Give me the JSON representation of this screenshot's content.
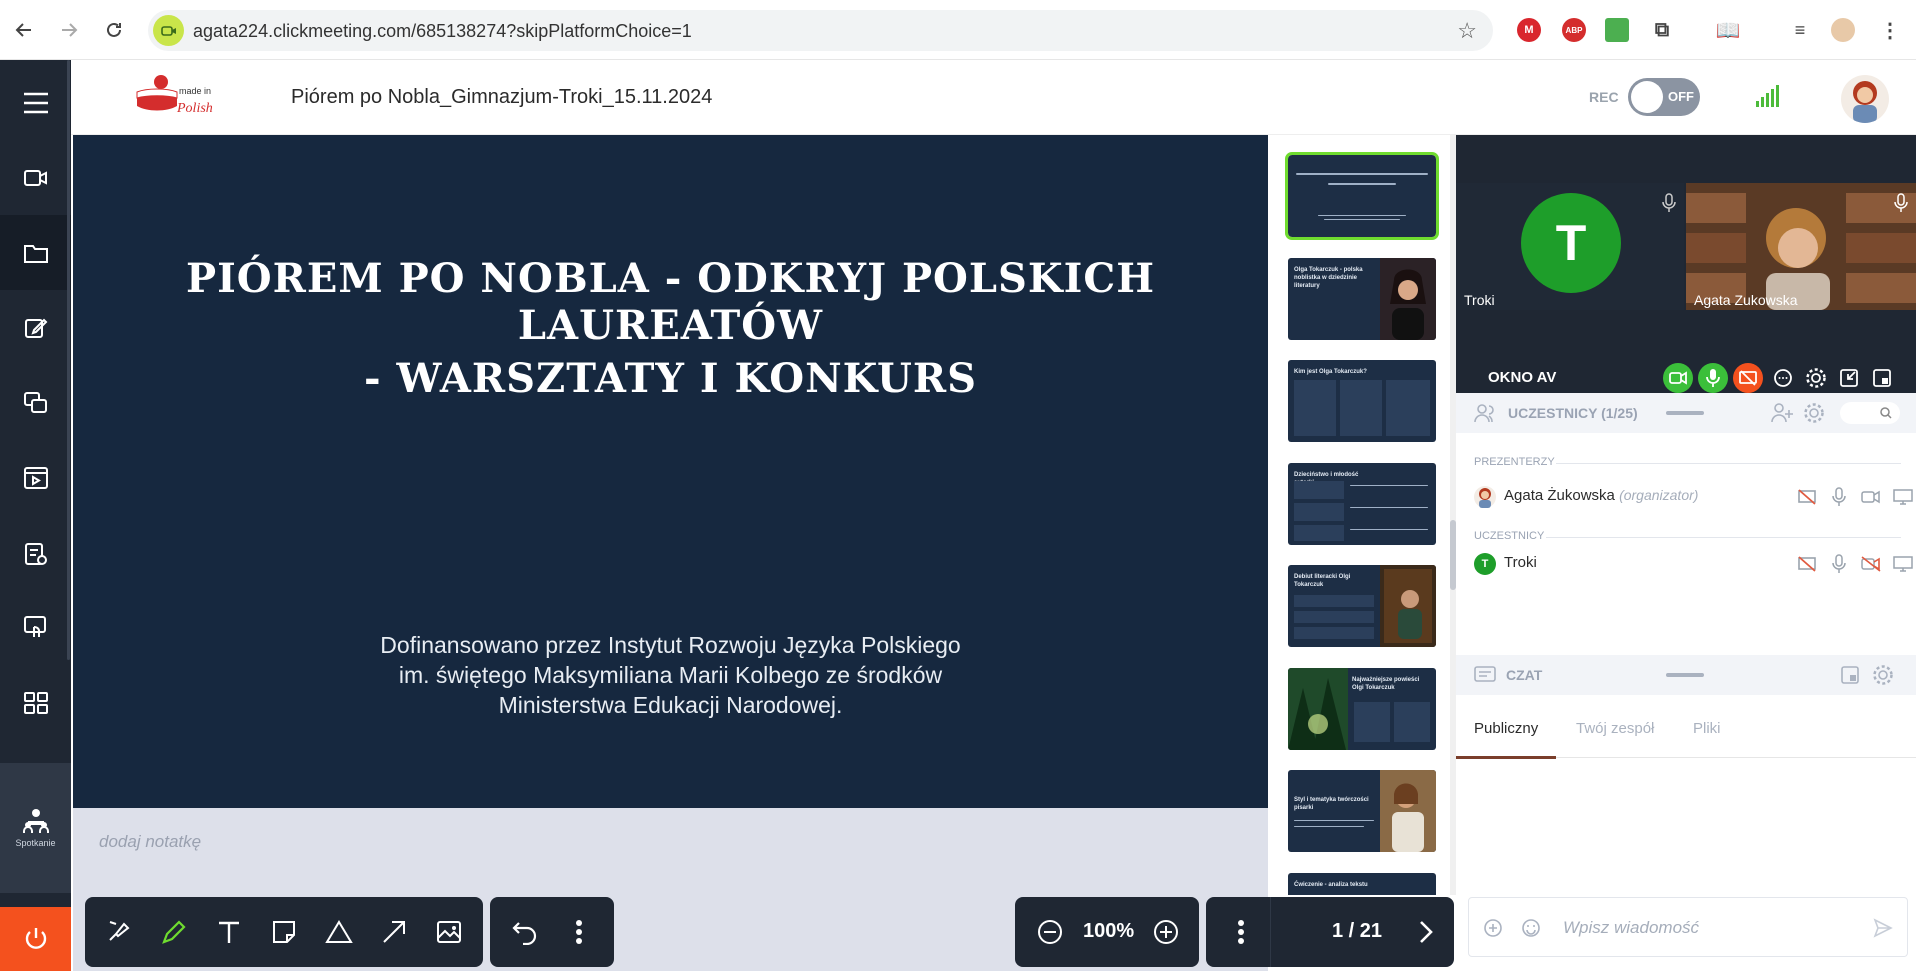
{
  "browser": {
    "url": "agata224.clickmeeting.com/685138274?skipPlatformChoice=1",
    "extensions": [
      "M",
      "ABP"
    ]
  },
  "sidebar": {
    "items": [
      "menu-icon",
      "camera-icon",
      "folder-icon",
      "edit-icon",
      "screens-icon",
      "media-icon",
      "clipboard-icon",
      "touch-icon",
      "apps-icon",
      "broadcast-icon"
    ],
    "meeting_label": "Spotkanie"
  },
  "header": {
    "meeting_title": "Piórem po Nobla_Gimnazjum-Troki_15.11.2024",
    "rec_label": "REC",
    "rec_state": "OFF"
  },
  "slide": {
    "title_line1": "PIÓREM PO NOBLA - ODKRYJ POLSKICH LAUREATÓW",
    "title_line2": "- WARSZTATY I KONKURS",
    "credit_line1": "Dofinansowano przez Instytut Rozwoju Języka Polskiego",
    "credit_line2": "im. świętego Maksymiliana Marii Kolbego ze środków",
    "credit_line3": "Ministerstwa Edukacji Narodowej.",
    "notes_placeholder": "dodaj notatkę"
  },
  "thumbnails": [
    {
      "title": "PIÓREM PO NOBLA - ODKRYJ POLSKICH LAUREATÓW - WARSZTATY I KONKURS"
    },
    {
      "title": "Olga Tokarczuk - polska noblistka w dziedzinie literatury"
    },
    {
      "title": "Kim jest Olga Tokarczuk?"
    },
    {
      "title": "Dzieciństwo i młodość autorki"
    },
    {
      "title": "Debiut literacki Olgi Tokarczuk"
    },
    {
      "title": "Najważniejsze powieści Olgi Tokarczuk"
    },
    {
      "title": "Styl i tematyka twórczości pisarki"
    },
    {
      "title": "Ćwiczenie - analiza tekstu"
    }
  ],
  "toolbar": {
    "zoom": "100%",
    "page": "1 / 21"
  },
  "video": {
    "tile1_initial": "T",
    "tile1_name": "Troki",
    "tile2_name": "Agata Zukowska",
    "av_title": "OKNO AV"
  },
  "participants": {
    "header": "UCZESTNICY (1/25)",
    "presenters_label": "PREZENTERZY",
    "presenter_name": "Agata Żukowska",
    "presenter_role": "(organizator)",
    "attendees_label": "UCZESTNICY",
    "attendee_initial": "T",
    "attendee_name": "Troki"
  },
  "chat": {
    "header": "CZAT",
    "tabs": [
      "Publiczny",
      "Twój zespół",
      "Pliki"
    ],
    "input_placeholder": "Wpisz wiadomość"
  },
  "colors": {
    "sidebar": "#1f2733",
    "slide_bg": "#16283f",
    "accent_green": "#6fdc2f",
    "power_orange": "#f4511e"
  }
}
